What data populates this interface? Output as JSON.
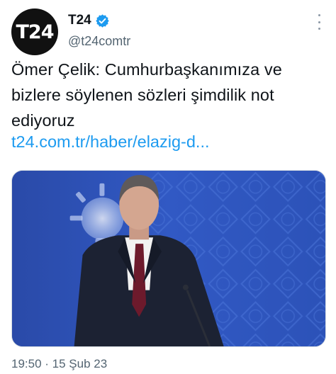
{
  "tweet": {
    "avatar_text": "T24",
    "display_name": "T24",
    "handle": "@t24comtr",
    "text": "Ömer Çelik: Cumhurbaşkanımıza ve bizlere söylenen sözleri şimdilik not ediyoruz",
    "link": "t24.com.tr/haber/elazig-d...",
    "timestamp": "19:50 · 15 Şub 23"
  },
  "icons": {
    "verified": "verified-badge-icon",
    "more": "more-options-icon"
  },
  "colors": {
    "link": "#1d9bf0",
    "verified": "#1d9bf0",
    "secondary_text": "#536471",
    "media_background": "#2c4fae"
  }
}
